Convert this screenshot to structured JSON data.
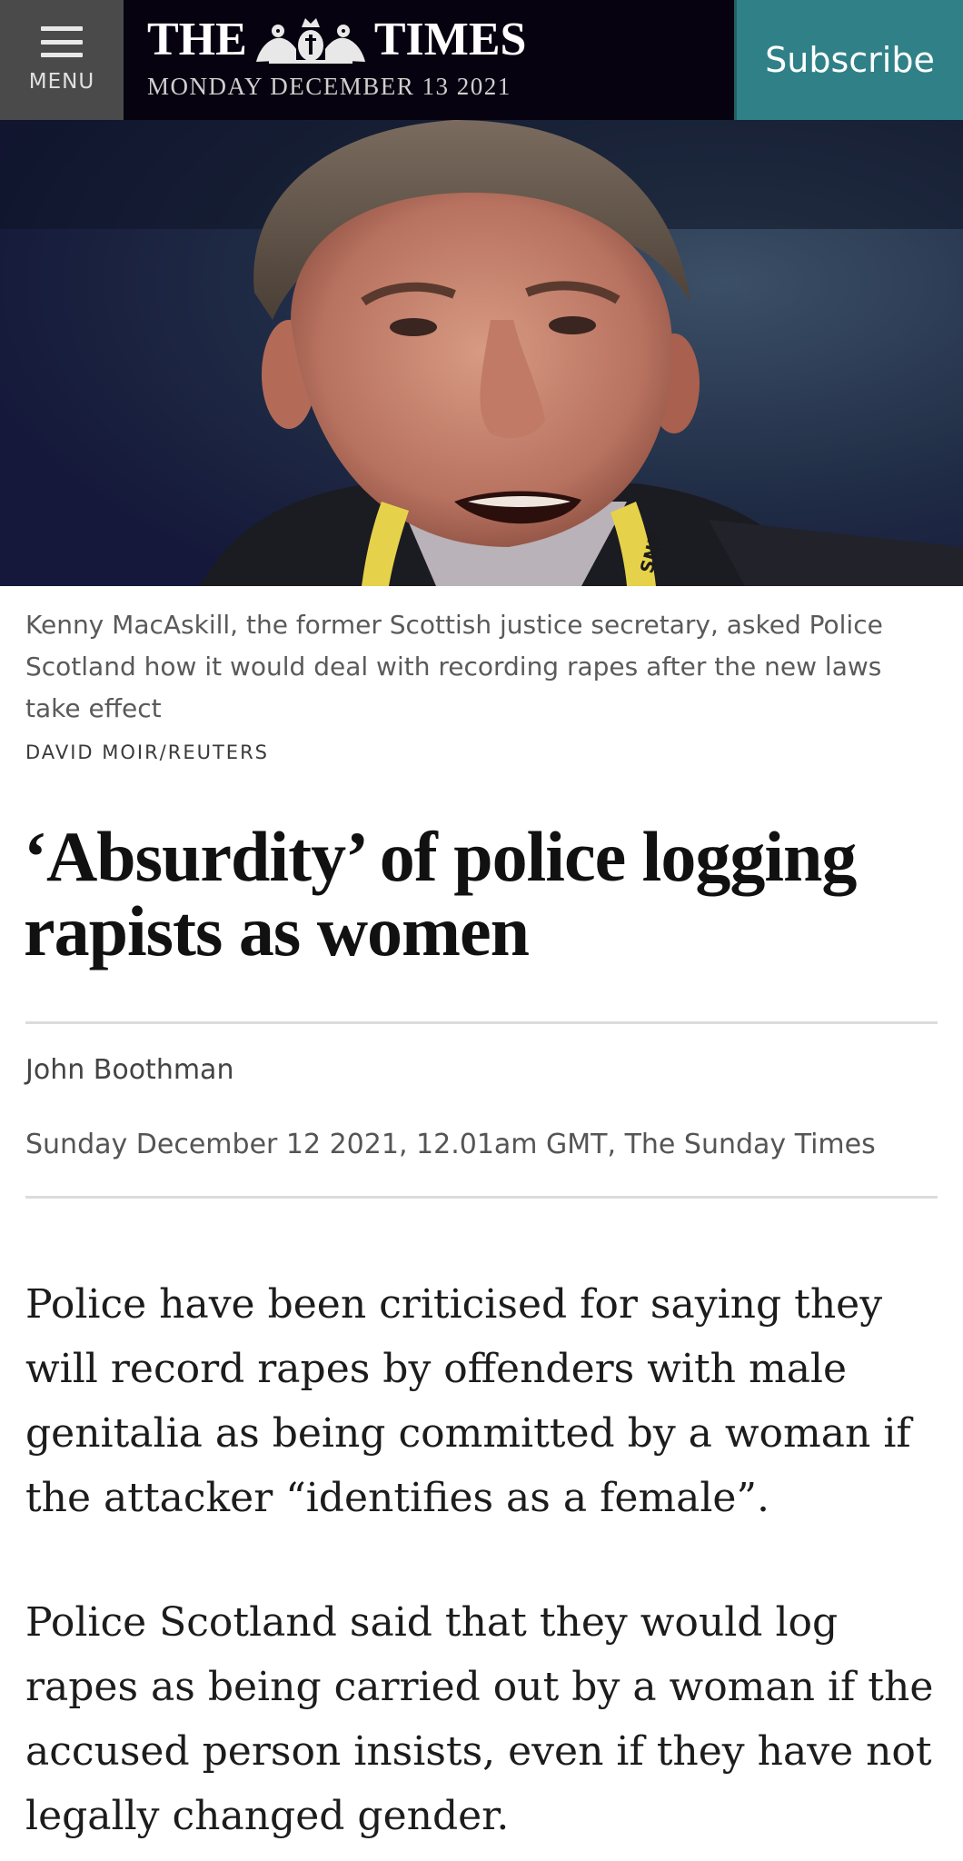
{
  "header": {
    "menu_label": "MENU",
    "masthead_left": "THE",
    "masthead_right": "TIMES",
    "date": "MONDAY DECEMBER 13 2021",
    "subscribe_label": "Subscribe"
  },
  "photo": {
    "caption": "Kenny MacAskill, the former Scottish justice secretary, asked Police Scotland how it would deal with recording rapes after the new laws take effect",
    "credit": "DAVID MOIR/REUTERS",
    "lanyard_text": "SNP"
  },
  "article": {
    "headline": "‘Absurdity’ of police logging rapists as women",
    "author": "John Boothman",
    "dateline": "Sunday December 12 2021, 12.01am GMT, The Sunday Times",
    "paragraphs": [
      "Police have been criticised for saying they will record rapes by offenders with male genitalia as being committed by a woman if the attacker “identifies as a female”.",
      "Police Scotland said that they would log rapes as being carried out by a woman if the accused person insists, even if they have not legally changed gender."
    ]
  },
  "colors": {
    "menu_bg": "#4a4a4a",
    "masthead_bg": "#06020f",
    "subscribe_bg": "#2f8187"
  }
}
